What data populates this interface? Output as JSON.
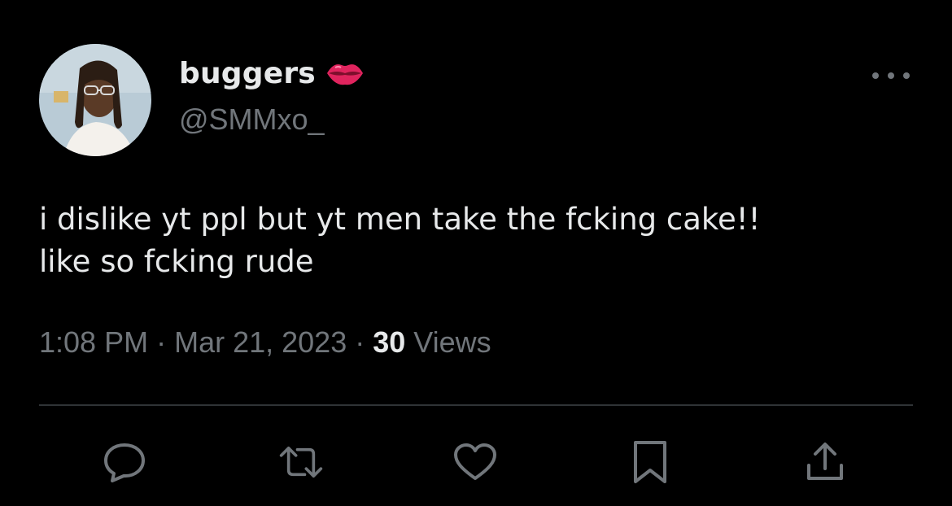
{
  "author": {
    "display_name": "buggers",
    "emoji_icon": "kiss-mark-lips-icon",
    "handle": "@SMMxo_"
  },
  "tweet": {
    "text_line1": "i dislike yt ppl but yt men take the fcking cake!!",
    "text_line2": "like so fcking rude"
  },
  "meta": {
    "time": "1:08 PM",
    "separator": "·",
    "date": "Mar 21, 2023",
    "views_count": "30",
    "views_label": "Views"
  },
  "actions": [
    "reply-icon",
    "retweet-icon",
    "like-icon",
    "bookmark-icon",
    "share-icon"
  ],
  "colors": {
    "background": "#000000",
    "primary_text": "#e7e9ea",
    "secondary_text": "#71767b",
    "divider": "#2f3336",
    "lips": "#e0245e"
  }
}
